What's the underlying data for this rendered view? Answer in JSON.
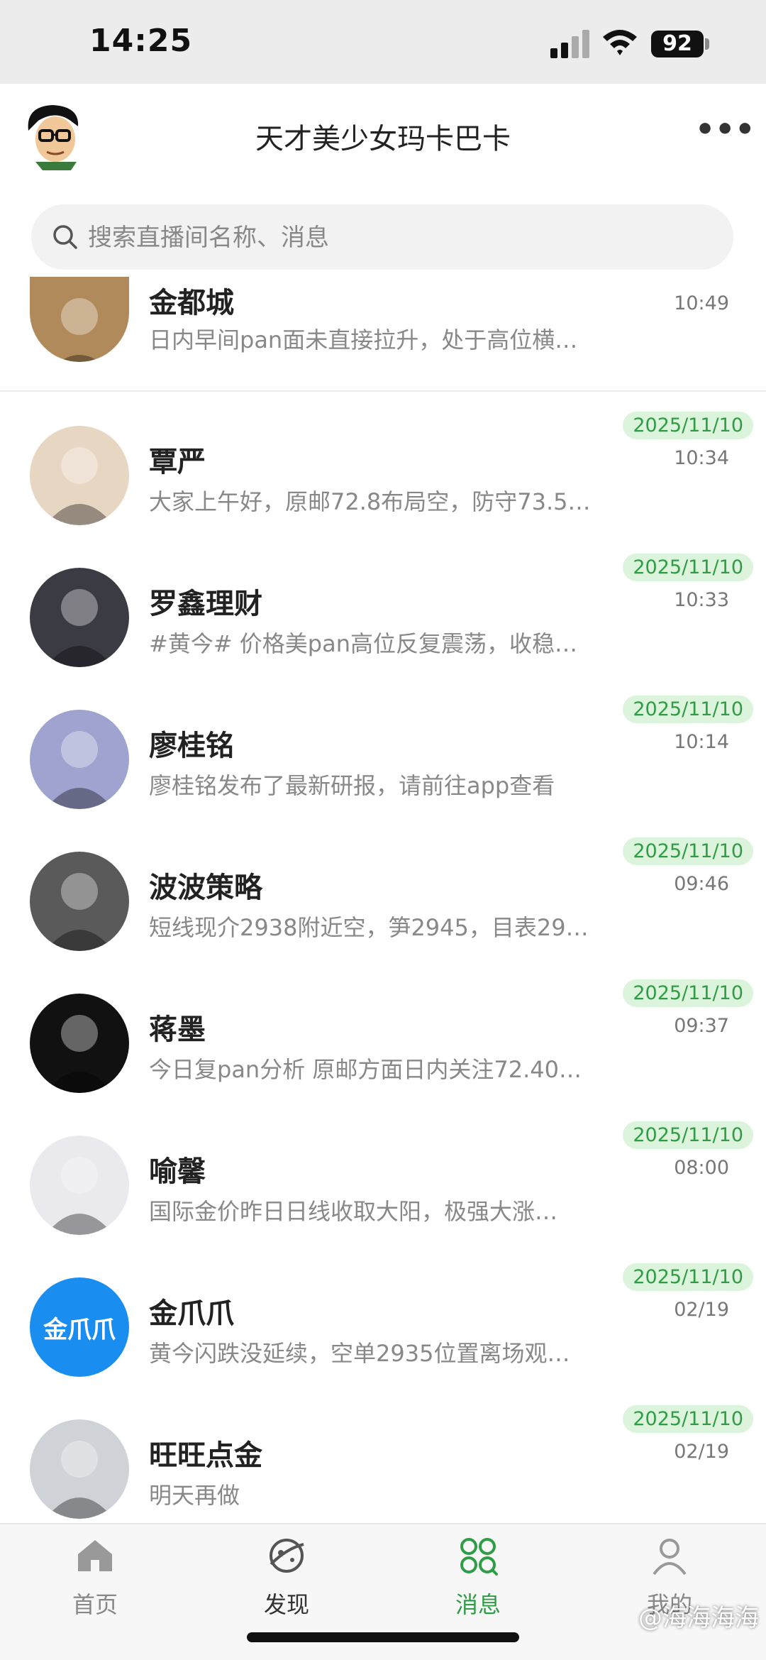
{
  "status_bar": {
    "time": "14:25",
    "battery": "92"
  },
  "header": {
    "title": "天才美少女玛卡巴卡",
    "more_label": "•••"
  },
  "search": {
    "placeholder": "搜索直播间名称、消息"
  },
  "conversations": [
    {
      "name": "金都城",
      "preview": "日内早间pan面未直接拉升，处于高位横…",
      "date": "",
      "time": "10:49",
      "avatar_color": "#b08a5a"
    },
    {
      "name": "覃严",
      "preview": "大家上午好，原邮72.8布局空，防守73.5…",
      "date": "2025/11/10",
      "time": "10:34",
      "avatar_color": "#e7d6c2"
    },
    {
      "name": "罗鑫理财",
      "preview": "#黄今# 价格美pan高位反复震荡，收稳…",
      "date": "2025/11/10",
      "time": "10:33",
      "avatar_color": "#3b3b44"
    },
    {
      "name": "廖桂铭",
      "preview": "廖桂铭发布了最新研报，请前往app查看",
      "date": "2025/11/10",
      "time": "10:14",
      "avatar_color": "#9fa3cf"
    },
    {
      "name": "波波策略",
      "preview": "短线现介2938附近空，笋2945，目表29…",
      "date": "2025/11/10",
      "time": "09:46",
      "avatar_color": "#5a5a5a"
    },
    {
      "name": "蒋墨",
      "preview": "今日复pan分析 原邮方面日内关注72.40…",
      "date": "2025/11/10",
      "time": "09:37",
      "avatar_color": "#111111"
    },
    {
      "name": "喻馨",
      "preview": "国际金价昨日日线收取大阳，极强大涨…",
      "date": "2025/11/10",
      "time": "08:00",
      "avatar_color": "#e9e9ee"
    },
    {
      "name": "金爪爪",
      "preview": "黄今闪跌没延续，空单2935位置离场观…",
      "date": "2025/11/10",
      "time": "02/19",
      "avatar_color": "#1a8df0",
      "avatar_text": "金爪爪"
    },
    {
      "name": "旺旺点金",
      "preview": "明天再做",
      "date": "2025/11/10",
      "time": "02/19",
      "avatar_color": "#cfd2d6"
    }
  ],
  "bottom_nav": [
    {
      "label": "首页",
      "icon": "home-icon"
    },
    {
      "label": "发现",
      "icon": "discover-icon"
    },
    {
      "label": "消息",
      "icon": "messages-icon",
      "active": true
    },
    {
      "label": "我的",
      "icon": "profile-icon"
    }
  ],
  "watermark": "@海海海海",
  "colors": {
    "accent": "#2f9d46",
    "date_badge_bg": "#dcf3dc"
  }
}
